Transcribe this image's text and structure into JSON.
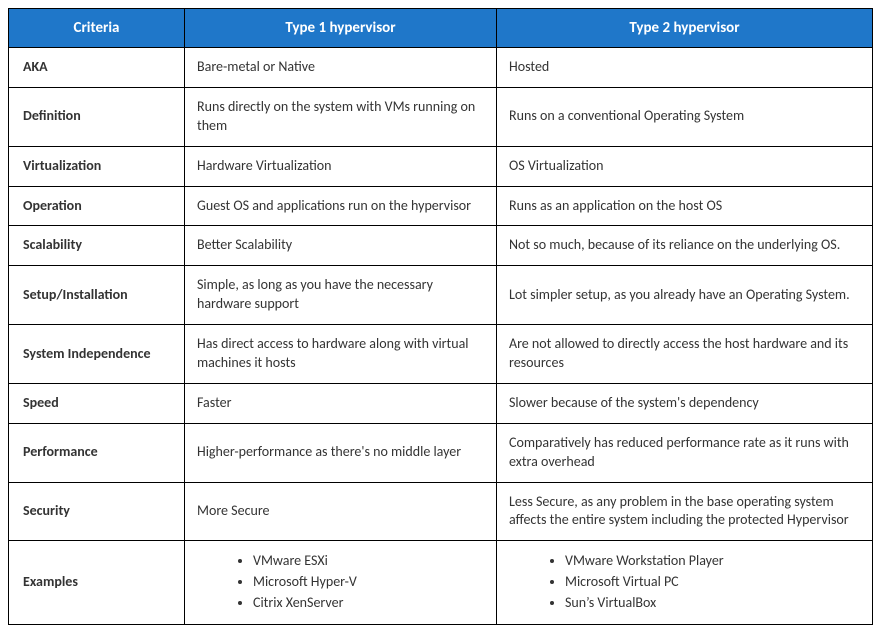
{
  "headers": {
    "criteria": "Criteria",
    "type1": "Type 1 hypervisor",
    "type2": "Type 2 hypervisor"
  },
  "rows": [
    {
      "criteria": "AKA",
      "type1": "Bare-metal or Native",
      "type2": "Hosted"
    },
    {
      "criteria": "Definition",
      "type1": "Runs directly on the system  with VMs running on them",
      "type2": "Runs on a conventional Operating System"
    },
    {
      "criteria": "Virtualization",
      "type1": "Hardware Virtualization",
      "type2": "OS Virtualization"
    },
    {
      "criteria": "Operation",
      "type1": "Guest OS and applications run on the hypervisor",
      "type2": "Runs as an application on the host OS"
    },
    {
      "criteria": "Scalability",
      "type1": "Better Scalability",
      "type2": "Not so much, because of its reliance on the underlying OS."
    },
    {
      "criteria": "Setup/Installation",
      "type1": "Simple, as long as you have the necessary hardware support",
      "type2": "Lot simpler setup, as you already have an Operating System."
    },
    {
      "criteria": "System Independence",
      "type1": "Has direct access to hardware along with virtual machines it hosts",
      "type2": "Are not allowed to directly access the host hardware and its resources"
    },
    {
      "criteria": "Speed",
      "type1": "Faster",
      "type2": "Slower because of the system's dependency"
    },
    {
      "criteria": "Performance",
      "type1": "Higher-performance as there's no middle layer",
      "type2": "Comparatively has reduced performance rate as it runs with extra overhead"
    },
    {
      "criteria": "Security",
      "type1": "More Secure",
      "type2": "Less Secure, as any problem in the base operating system affects the entire system including the protected Hypervisor"
    }
  ],
  "examples": {
    "criteria": "Examples",
    "type1": [
      "VMware ESXi",
      "Microsoft Hyper-V",
      "Citrix XenServer"
    ],
    "type2": [
      "VMware Workstation Player",
      "Microsoft Virtual PC",
      "Sun’s VirtualBox"
    ]
  }
}
